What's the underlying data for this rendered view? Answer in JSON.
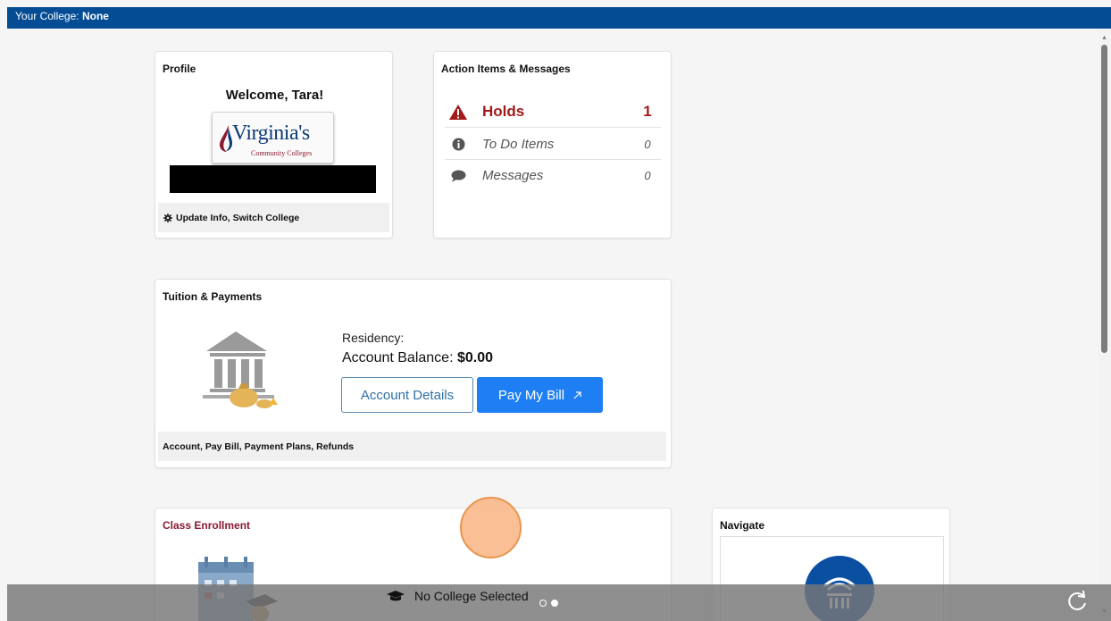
{
  "topbar": {
    "college_label": "Your College:",
    "college_value": "None"
  },
  "profile": {
    "title": "Profile",
    "welcome": "Welcome, Tara!",
    "logo_name": "Virginia's",
    "logo_sub": "Community Colleges",
    "footer_link": "Update Info, Switch College"
  },
  "actions": {
    "title": "Action Items & Messages",
    "items": [
      {
        "label": "Holds",
        "count": "1",
        "icon": "warning-triangle-icon"
      },
      {
        "label": "To Do Items",
        "count": "0",
        "icon": "info-circle-icon"
      },
      {
        "label": "Messages",
        "count": "0",
        "icon": "chat-bubble-icon"
      }
    ]
  },
  "tuition": {
    "title": "Tuition & Payments",
    "residency_label": "Residency:",
    "balance_label": "Account Balance:",
    "balance_value": "$0.00",
    "details_button": "Account Details",
    "pay_button": "Pay My Bill",
    "footer_link": "Account, Pay Bill, Payment Plans, Refunds"
  },
  "enrollment": {
    "title": "Class Enrollment"
  },
  "navigate": {
    "title": "Navigate"
  },
  "bottom_bar": {
    "college_select": "No College Selected"
  },
  "colors": {
    "topbar": "#044c93",
    "holds": "#a31a1a",
    "pay_button": "#1e7ef3",
    "enrollment_title": "#8a1a30"
  }
}
